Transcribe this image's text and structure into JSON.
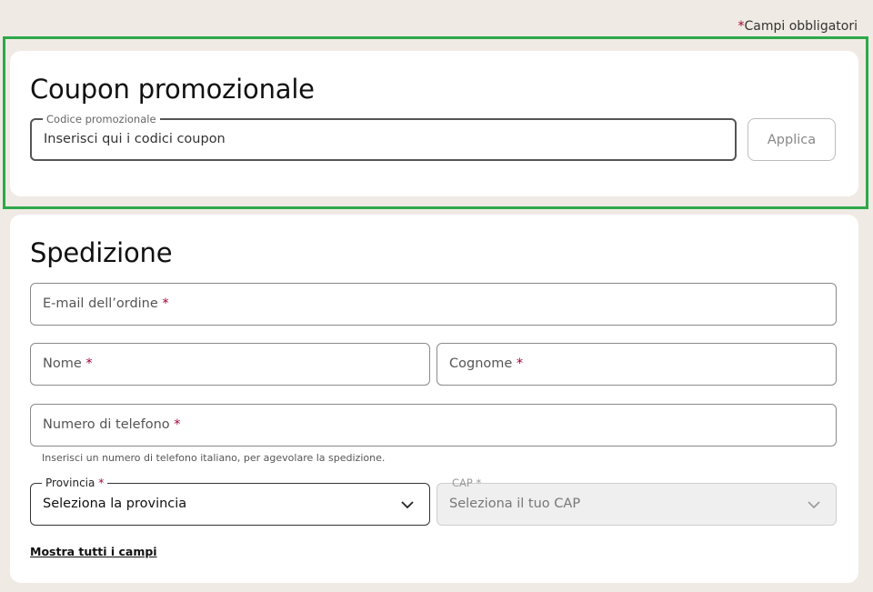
{
  "header": {
    "required_star": "*",
    "required_note": "Campi obbligatori"
  },
  "coupon": {
    "title": "Coupon promozionale",
    "field_label": "Codice promozionale",
    "field_placeholder": "Inserisci qui i codici coupon",
    "apply_label": "Applica"
  },
  "shipping": {
    "title": "Spedizione",
    "email_label": "E-mail dell’ordine",
    "first_name_label": "Nome",
    "last_name_label": "Cognome",
    "phone_label": "Numero di telefono",
    "phone_helper": "Inserisci un numero di telefono italiano, per agevolare la spedizione.",
    "province_label": "Provincia",
    "province_value": "Seleziona la provincia",
    "cap_label": "CAP",
    "cap_value": "Seleziona il tuo CAP",
    "show_all_label": "Mostra tutti i campi",
    "required_star": "*"
  },
  "colors": {
    "background": "#efebe4",
    "required_star": "#a50034",
    "highlight": "#2ea84a"
  }
}
